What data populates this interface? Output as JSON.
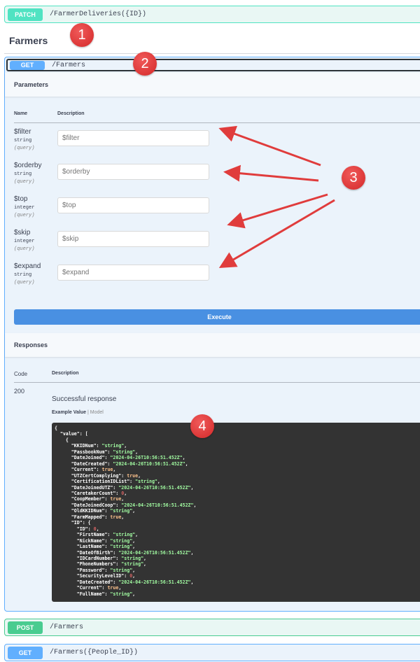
{
  "ops": {
    "patch": {
      "method": "PATCH",
      "path": "/FarmerDeliveries({ID})"
    },
    "get": {
      "method": "GET",
      "path": "/Farmers"
    },
    "post": {
      "method": "POST",
      "path": "/Farmers"
    },
    "get_by_id": {
      "method": "GET",
      "path": "/Farmers({People_ID})"
    }
  },
  "tag": {
    "title": "Farmers"
  },
  "parameters": {
    "section_title": "Parameters",
    "col_name": "Name",
    "col_description": "Description",
    "items": [
      {
        "name": "$filter",
        "type": "string",
        "in": "(query)",
        "placeholder": "$filter"
      },
      {
        "name": "$orderby",
        "type": "string",
        "in": "(query)",
        "placeholder": "$orderby"
      },
      {
        "name": "$top",
        "type": "integer",
        "in": "(query)",
        "placeholder": "$top"
      },
      {
        "name": "$skip",
        "type": "integer",
        "in": "(query)",
        "placeholder": "$skip"
      },
      {
        "name": "$expand",
        "type": "string",
        "in": "(query)",
        "placeholder": "$expand"
      }
    ]
  },
  "execute_label": "Execute",
  "responses": {
    "section_title": "Responses",
    "col_code": "Code",
    "col_description": "Description",
    "code": "200",
    "description": "Successful response",
    "example_value_tab": "Example Value",
    "model_tab": "Model",
    "example_lines": [
      "{",
      "  \"value\": [",
      "    {",
      "      \"KKIDNum\": \"string\",",
      "      \"PassbookNum\": \"string\",",
      "      \"DateJoined\": \"2024-04-26T10:56:51.452Z\",",
      "      \"DateCreated\": \"2024-04-26T10:56:51.452Z\",",
      "      \"Current\": true,",
      "      \"UTZCertComplying\": true,",
      "      \"CertificationIDList\": \"string\",",
      "      \"DateJoinedUTZ\": \"2024-04-26T10:56:51.452Z\",",
      "      \"CaretakerCount\": 0,",
      "      \"CoopMember\": true,",
      "      \"DateJoinedCoop\": \"2024-04-26T10:56:51.452Z\",",
      "      \"OldKKIDNum\": \"string\",",
      "      \"FarmMapped\": true,",
      "      \"ID\": {",
      "        \"ID\": 0,",
      "        \"FirstName\": \"string\",",
      "        \"NickName\": \"string\",",
      "        \"LastName\": \"string\",",
      "        \"DateOfBirth\": \"2024-04-26T10:56:51.452Z\",",
      "        \"IDCardNumber\": \"string\",",
      "        \"PhoneNumbers\": \"string\",",
      "        \"Password\": \"string\",",
      "        \"SecurityLevelID\": 0,",
      "        \"DateCreated\": \"2024-04-26T10:56:51.452Z\",",
      "        \"Current\": true,",
      "        \"FullName\": \"string\","
    ]
  },
  "markers": [
    "1",
    "2",
    "3",
    "4"
  ],
  "colors": {
    "get": "#61affe",
    "post": "#49cc90",
    "patch": "#50e3c2",
    "execute": "#4990e2",
    "marker": "#d93636",
    "arrow": "#e03c3c"
  }
}
